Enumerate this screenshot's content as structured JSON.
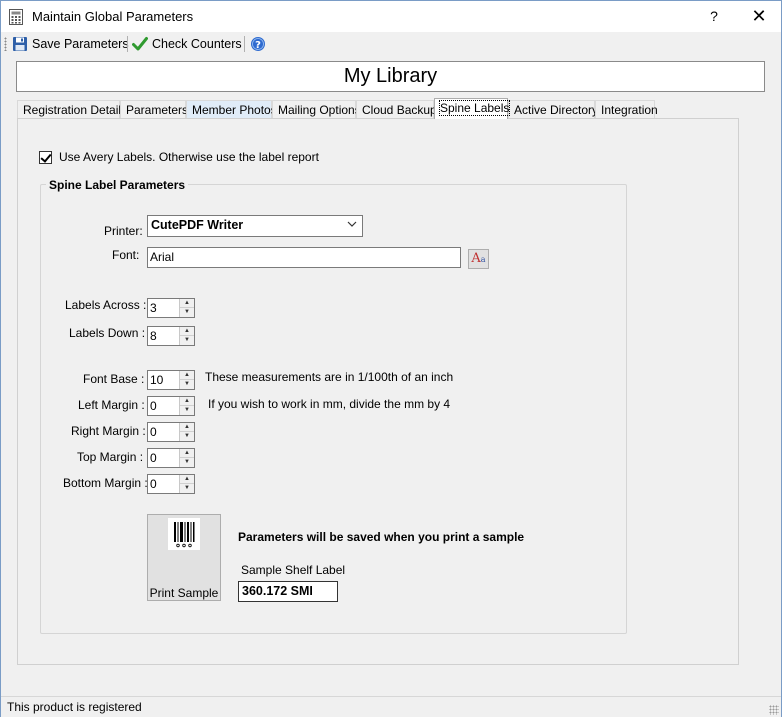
{
  "window": {
    "title": "Maintain Global Parameters",
    "help_label": "?",
    "close_label": "✕"
  },
  "toolbar": {
    "save_label": "Save Parameters",
    "check_label": "Check Counters"
  },
  "library_name": "My Library",
  "tabs": [
    {
      "label": "Registration Details"
    },
    {
      "label": "Parameters"
    },
    {
      "label": "Member Photos"
    },
    {
      "label": "Mailing Options"
    },
    {
      "label": "Cloud Backup"
    },
    {
      "label": "Spine Labels"
    },
    {
      "label": "Active Directory"
    },
    {
      "label": "Integration"
    }
  ],
  "spine": {
    "use_avery_label": "Use Avery Labels. Otherwise use the label report",
    "use_avery_checked": true,
    "group_title": "Spine Label Parameters",
    "printer_label": "Printer:",
    "printer_value": "CutePDF Writer",
    "font_label": "Font:",
    "font_value": "Arial",
    "labels_across_label": "Labels Across :",
    "labels_across_value": "3",
    "labels_down_label": "Labels Down :",
    "labels_down_value": "8",
    "font_base_label": "Font Base :",
    "font_base_value": "10",
    "left_margin_label": "Left Margin :",
    "left_margin_value": "0",
    "right_margin_label": "Right Margin :",
    "right_margin_value": "0",
    "top_margin_label": "Top Margin :",
    "top_margin_value": "0",
    "bottom_margin_label": "Bottom Margin :",
    "bottom_margin_value": "0",
    "measurement_note": "These measurements are in 1/100th of an inch",
    "mm_note": "If you wish to work in mm, divide the mm by 4",
    "print_sample_label": "Print Sample",
    "params_saved_note": "Parameters will be saved when you print a sample",
    "sample_shelf_label": "Sample Shelf Label",
    "sample_shelf_value": "360.172 SMI"
  },
  "status": {
    "text": "This product is registered"
  }
}
